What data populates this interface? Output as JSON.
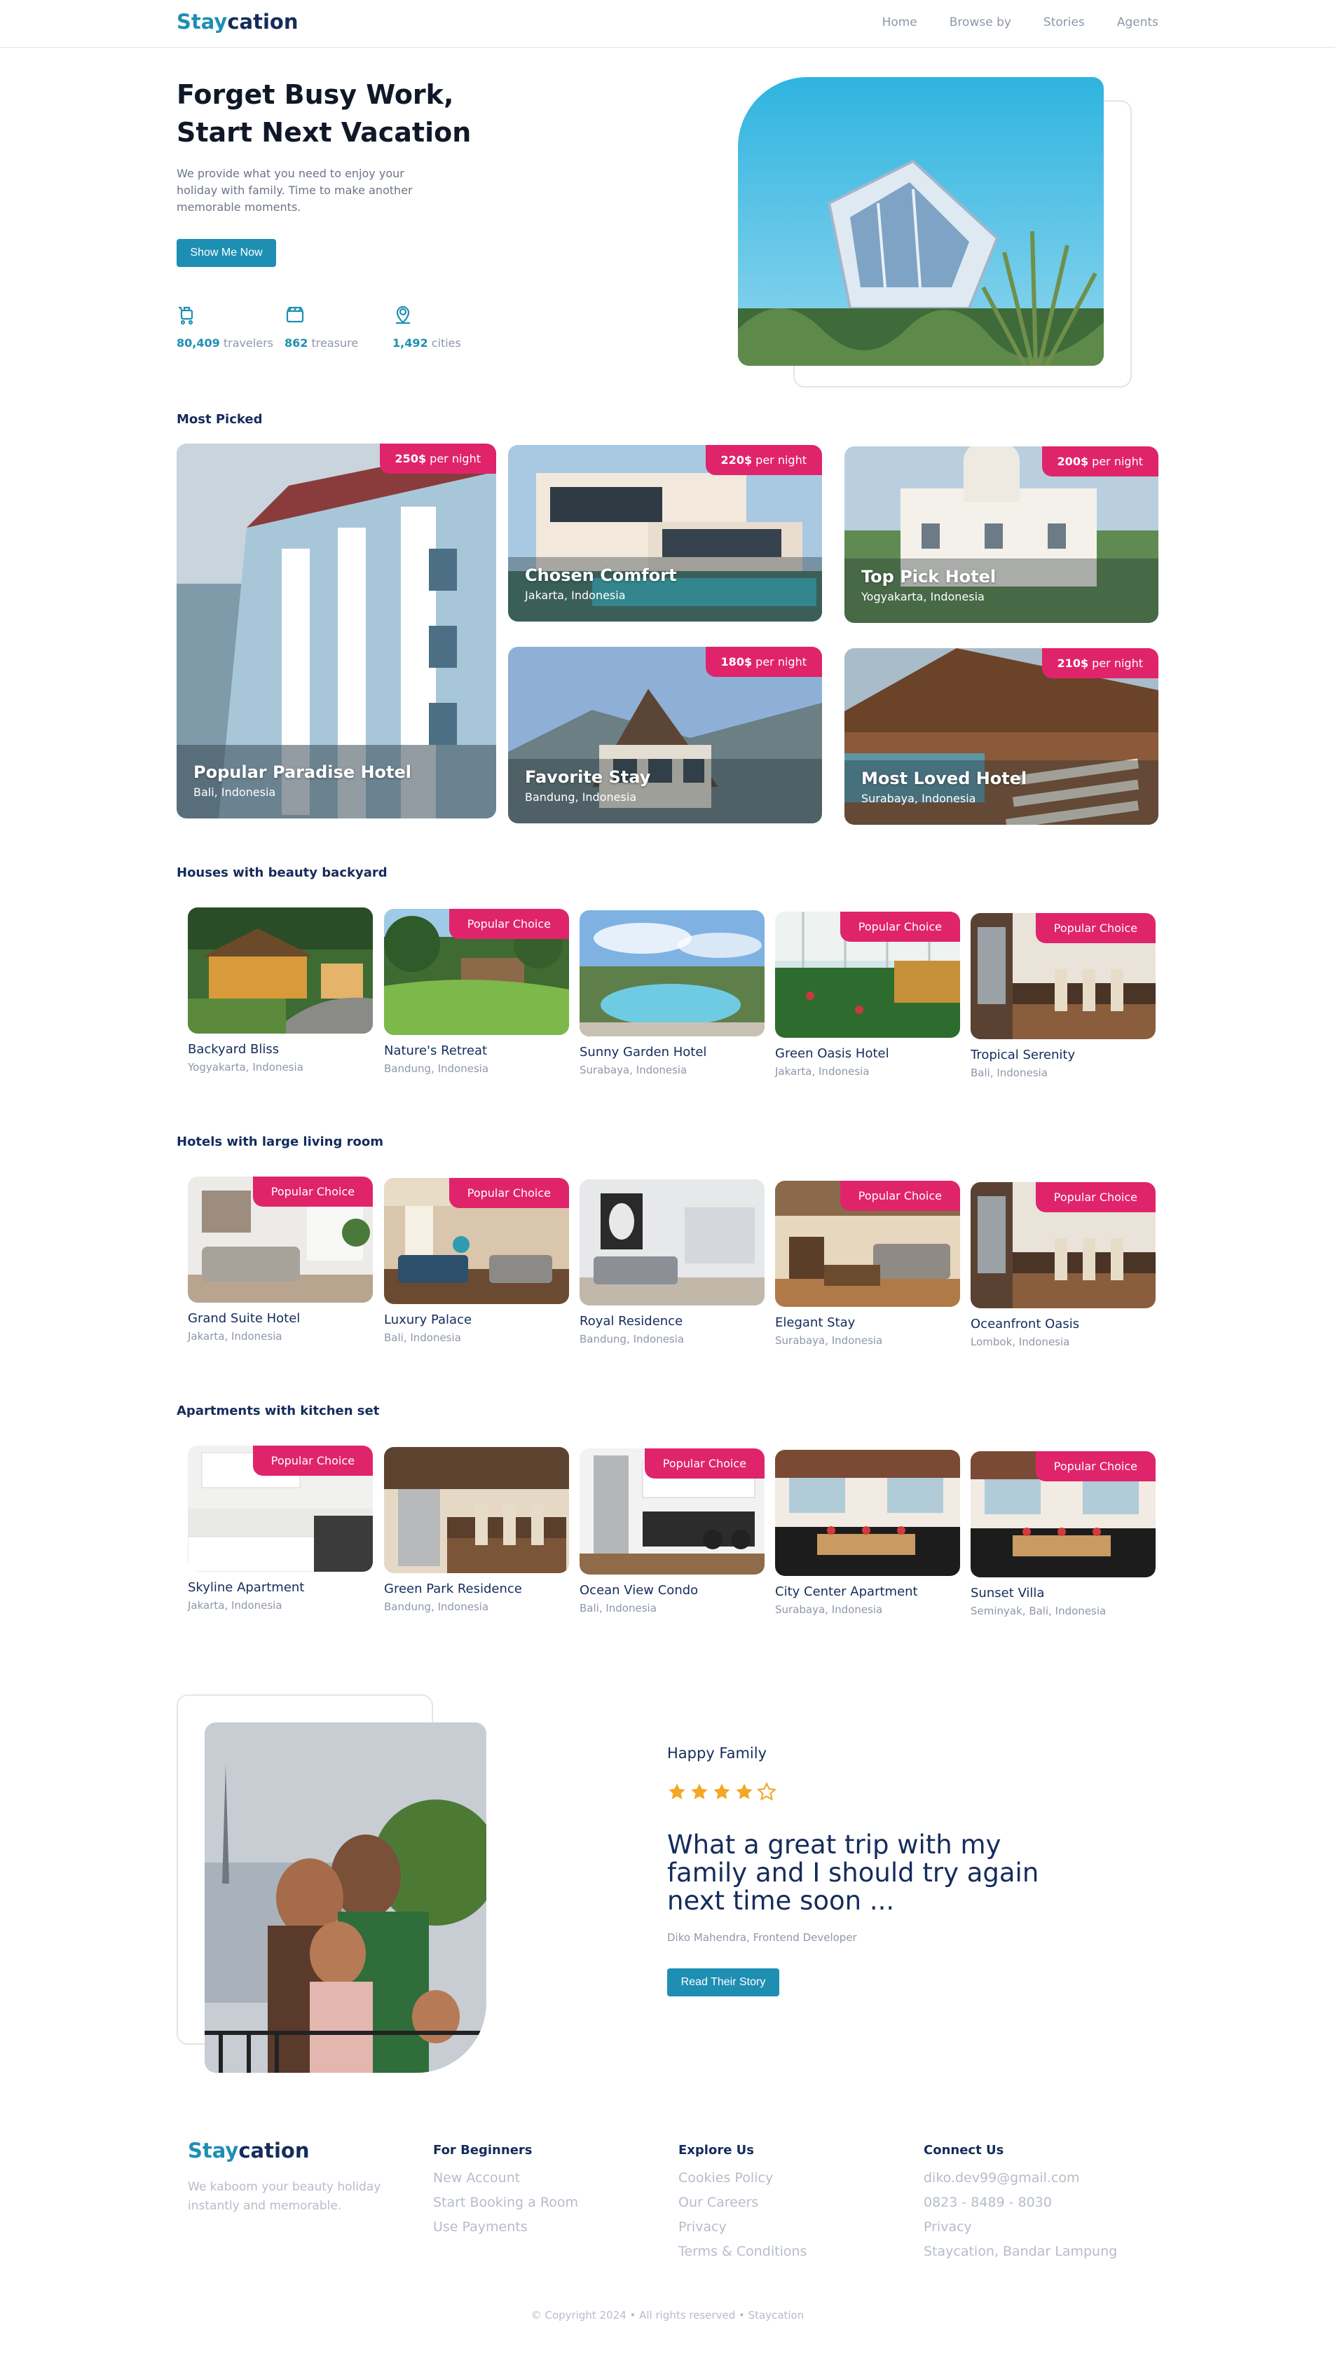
{
  "header": {
    "brand_prefix": "Stay",
    "brand_suffix": "cation",
    "nav": [
      "Home",
      "Browse by",
      "Stories",
      "Agents"
    ]
  },
  "hero": {
    "title_line1": "Forget Busy Work,",
    "title_line2": "Start Next Vacation",
    "subtitle": "We provide what you need to enjoy your holiday with family. Time to make another memorable moments.",
    "button": "Show Me Now",
    "stats": [
      {
        "value": "80,409",
        "label": "travelers",
        "icon": "traveler-icon"
      },
      {
        "value": "862",
        "label": "treasure",
        "icon": "treasure-icon"
      },
      {
        "value": "1,492",
        "label": "cities",
        "icon": "location-pin-icon"
      }
    ]
  },
  "most_picked": {
    "title": "Most Picked",
    "price_suffix": "per night",
    "items": [
      {
        "price": "250$",
        "name": "Popular Paradise Hotel",
        "location": "Bali, Indonesia"
      },
      {
        "price": "220$",
        "name": "Chosen Comfort",
        "location": "Jakarta, Indonesia"
      },
      {
        "price": "200$",
        "name": "Top Pick Hotel",
        "location": "Yogyakarta, Indonesia"
      },
      {
        "price": "180$",
        "name": "Favorite Stay",
        "location": "Bandung, Indonesia"
      },
      {
        "price": "210$",
        "name": "Most Loved Hotel",
        "location": "Surabaya, Indonesia"
      }
    ]
  },
  "popular_label": "Popular Choice",
  "categories": [
    {
      "title": "Houses with beauty backyard",
      "items": [
        {
          "name": "Backyard Bliss",
          "location": "Yogyakarta, Indonesia",
          "popular": false
        },
        {
          "name": "Nature's Retreat",
          "location": "Bandung, Indonesia",
          "popular": true
        },
        {
          "name": "Sunny Garden Hotel",
          "location": "Surabaya, Indonesia",
          "popular": false
        },
        {
          "name": "Green Oasis Hotel",
          "location": "Jakarta, Indonesia",
          "popular": true
        },
        {
          "name": "Tropical Serenity",
          "location": "Bali, Indonesia",
          "popular": true
        }
      ]
    },
    {
      "title": "Hotels with large living room",
      "items": [
        {
          "name": "Grand Suite Hotel",
          "location": "Jakarta, Indonesia",
          "popular": true
        },
        {
          "name": "Luxury Palace",
          "location": "Bali, Indonesia",
          "popular": true
        },
        {
          "name": "Royal Residence",
          "location": "Bandung, Indonesia",
          "popular": false
        },
        {
          "name": "Elegant Stay",
          "location": "Surabaya, Indonesia",
          "popular": true
        },
        {
          "name": "Oceanfront Oasis",
          "location": "Lombok, Indonesia",
          "popular": true
        }
      ]
    },
    {
      "title": "Apartments with kitchen set",
      "items": [
        {
          "name": "Skyline Apartment",
          "location": "Jakarta, Indonesia",
          "popular": true
        },
        {
          "name": "Green Park Residence",
          "location": "Bandung, Indonesia",
          "popular": false
        },
        {
          "name": "Ocean View Condo",
          "location": "Bali, Indonesia",
          "popular": true
        },
        {
          "name": "City Center Apartment",
          "location": "Surabaya, Indonesia",
          "popular": false
        },
        {
          "name": "Sunset Villa",
          "location": "Seminyak, Bali, Indonesia",
          "popular": true
        }
      ]
    }
  ],
  "testimonial": {
    "label": "Happy Family",
    "rating": 4,
    "rating_max": 5,
    "quote": "What a great trip with my family and I should try again next time soon ...",
    "author": "Diko Mahendra, Frontend Developer",
    "button": "Read Their Story"
  },
  "footer": {
    "brand_prefix": "Stay",
    "brand_suffix": "cation",
    "tagline": "We kaboom your beauty holiday instantly and memorable.",
    "columns": [
      {
        "title": "For Beginners",
        "links": [
          "New Account",
          "Start Booking a Room",
          "Use Payments"
        ]
      },
      {
        "title": "Explore Us",
        "links": [
          "Cookies Policy",
          "Our Careers",
          "Privacy",
          "Terms & Conditions"
        ]
      },
      {
        "title": "Connect Us",
        "links": [
          "diko.dev99@gmail.com",
          "0823 - 8489 - 8030",
          "Privacy",
          "Staycation, Bandar Lampung"
        ]
      }
    ],
    "copyright": "© Copyright 2024 • All rights reserved • Staycation"
  },
  "colors": {
    "primary": "#1e8fb3",
    "navy": "#152c5b",
    "badge": "#e0246b",
    "muted": "#8e97a8",
    "star": "#f5a623"
  }
}
